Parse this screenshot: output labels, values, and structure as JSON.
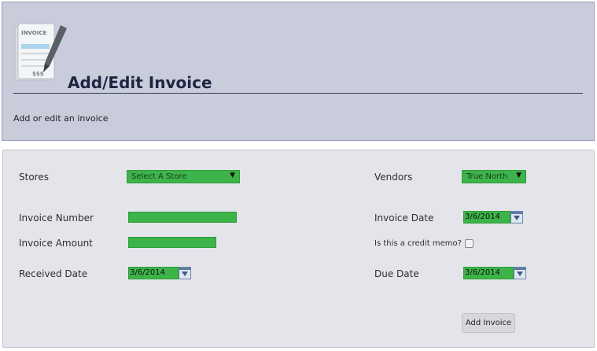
{
  "header": {
    "title": "Add/Edit Invoice",
    "subtitle": "Add or edit an invoice",
    "logo_text": "INVOICE",
    "logo_money": "$$$"
  },
  "form": {
    "stores_label": "Stores",
    "stores_value": "Select A Store",
    "vendors_label": "Vendors",
    "vendors_value": "True North",
    "invoice_number_label": "Invoice Number",
    "invoice_number_value": "",
    "invoice_date_label": "Invoice Date",
    "invoice_date_value": "3/6/2014",
    "invoice_amount_label": "Invoice Amount",
    "invoice_amount_value": "",
    "credit_memo_label": "Is this a credit memo?",
    "credit_memo_checked": false,
    "received_date_label": "Received Date",
    "received_date_value": "3/6/2014",
    "due_date_label": "Due Date",
    "due_date_value": "3/6/2014",
    "submit_label": "Add Invoice"
  },
  "colors": {
    "header_bg": "#c8ccdb",
    "panel_bg": "#e4e5ea",
    "field_green": "#3db44a"
  }
}
